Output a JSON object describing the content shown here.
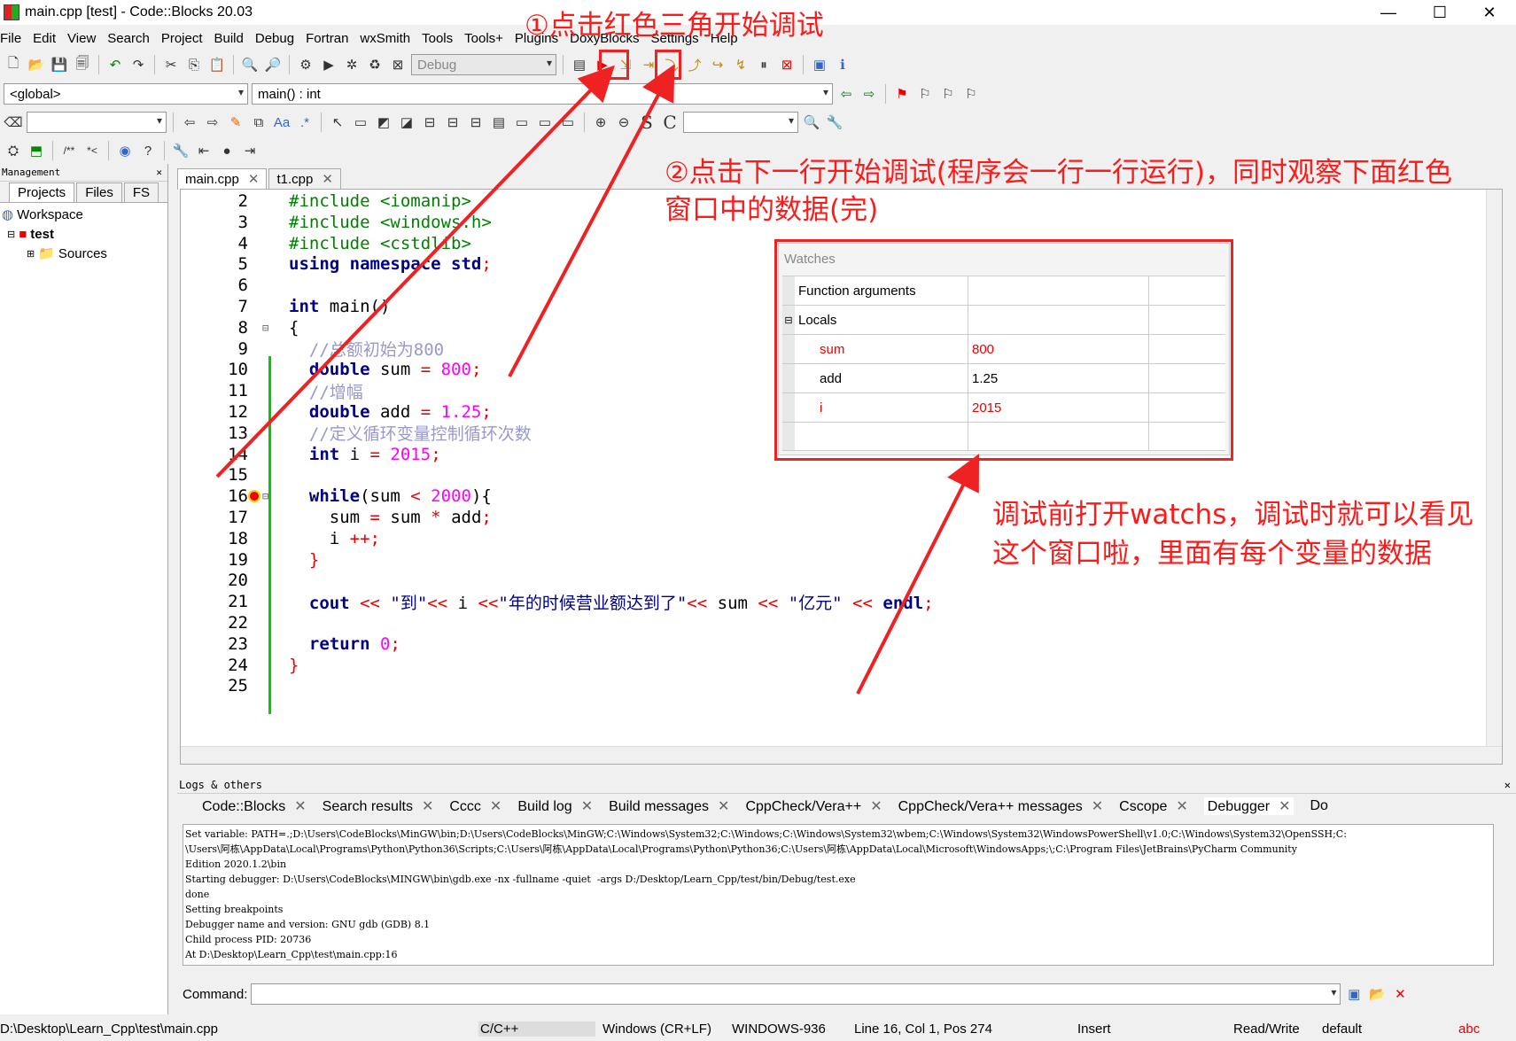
{
  "window": {
    "title": "main.cpp [test] - Code::Blocks 20.03"
  },
  "menu": [
    "File",
    "Edit",
    "View",
    "Search",
    "Project",
    "Build",
    "Debug",
    "Fortran",
    "wxSmith",
    "Tools",
    "Tools+",
    "Plugins",
    "DoxyBlocks",
    "Settings",
    "Help"
  ],
  "toolbar": {
    "build_target": "Debug",
    "scope": "<global>",
    "function": "main() : int"
  },
  "management": {
    "title": "Management",
    "tabs": [
      "Projects",
      "Files",
      "FS"
    ],
    "workspace": "Workspace",
    "project": "test",
    "sources": "Sources"
  },
  "editor": {
    "tabs": [
      "main.cpp",
      "t1.cpp"
    ],
    "lines": [
      "2",
      "3",
      "4",
      "5",
      "6",
      "7",
      "8",
      "9",
      "10",
      "11",
      "12",
      "13",
      "14",
      "15",
      "16",
      "17",
      "18",
      "19",
      "20",
      "21",
      "22",
      "23",
      "24",
      "25"
    ]
  },
  "code": {
    "l2a": "#include ",
    "l2b": "<iomanip>",
    "l3a": "#include ",
    "l3b": "<windows.h>",
    "l4a": "#include ",
    "l4b": "<cstdlib>",
    "l5a": "using namespace ",
    "l5b": "std",
    "l7a": "int ",
    "l7b": "main()",
    "l8": "{",
    "l9": "//总额初始为800",
    "l10a": "double ",
    "l10b": "sum ",
    "l10c": "= ",
    "l10d": "800",
    "l11": "//增幅",
    "l12a": "double ",
    "l12b": "add ",
    "l12c": "= ",
    "l12d": "1.25",
    "l13": "//定义循环变量控制循环次数",
    "l14a": "int ",
    "l14b": "i ",
    "l14c": "= ",
    "l14d": "2015",
    "l16a": "while",
    "l16b": "(sum ",
    "l16c": "< ",
    "l16d": "2000",
    "l16e": "){",
    "l17a": "sum ",
    "l17b": "= ",
    "l17c": "sum ",
    "l17d": "* ",
    "l17e": "add",
    "l18a": "i ",
    "l18b": "++",
    "l19": "}",
    "l21a": "cout ",
    "l21b": "<< ",
    "l21c": "\"到\"",
    "l21d": "<< ",
    "l21e": "i ",
    "l21f": "<<",
    "l21g": "\"年的时候营业额达到了\"",
    "l21h": "<< ",
    "l21i": "sum ",
    "l21j": "<< ",
    "l21k": "\"亿元\" ",
    "l21l": "<< ",
    "l21m": "endl",
    "l23a": "return ",
    "l23b": "0",
    "l24": "}"
  },
  "watches": {
    "title": "Watches",
    "rows": [
      {
        "name": "Function arguments",
        "value": ""
      },
      {
        "name": "Locals",
        "value": ""
      },
      {
        "name": "sum",
        "value": "800"
      },
      {
        "name": "add",
        "value": "1.25"
      },
      {
        "name": "i",
        "value": "2015"
      }
    ]
  },
  "annotations": {
    "a1": "①点击红色三角开始调试",
    "a2a": "②点击下一行开始调试(程序会一行一行运行)，同时观察下面红色",
    "a2b": "窗口中的数据(完)",
    "a3a": "调试前打开watchs，调试时就可以看见",
    "a3b": "这个窗口啦，里面有每个变量的数据"
  },
  "logs": {
    "title": "Logs & others",
    "tabs": [
      "Code::Blocks",
      "Search results",
      "Cccc",
      "Build log",
      "Build messages",
      "CppCheck/Vera++",
      "CppCheck/Vera++ messages",
      "Cscope",
      "Debugger",
      "Do"
    ],
    "text": "Set variable: PATH=.;D:\\Users\\CodeBlocks\\MinGW\\bin;D:\\Users\\CodeBlocks\\MinGW;C:\\Windows\\System32;C:\\Windows;C:\\Windows\\System32\\wbem;C:\\Windows\\System32\\WindowsPowerShell\\v1.0;C:\\Windows\\System32\\OpenSSH;C:\n\\Users\\阿栋\\AppData\\Local\\Programs\\Python\\Python36\\Scripts;C:\\Users\\阿栋\\AppData\\Local\\Programs\\Python\\Python36;C:\\Users\\阿栋\\AppData\\Local\\Microsoft\\WindowsApps;\\;C:\\Program Files\\JetBrains\\PyCharm Community\nEdition 2020.1.2\\bin\nStarting debugger: D:\\Users\\CodeBlocks\\MINGW\\bin\\gdb.exe -nx -fullname -quiet  -args D:/Desktop/Learn_Cpp/test/bin/Debug/test.exe\ndone\nSetting breakpoints\nDebugger name and version: GNU gdb (GDB) 8.1\nChild process PID: 20736\nAt D:\\Desktop\\Learn_Cpp\\test\\main.cpp:16",
    "command_label": "Command:"
  },
  "status": {
    "path": "D:\\Desktop\\Learn_Cpp\\test\\main.cpp",
    "lang": "C/C++",
    "eol": "Windows (CR+LF)",
    "enc": "WINDOWS-936",
    "pos": "Line 16, Col 1, Pos 274",
    "mode": "Insert",
    "rw": "Read/Write",
    "profile": "default"
  }
}
